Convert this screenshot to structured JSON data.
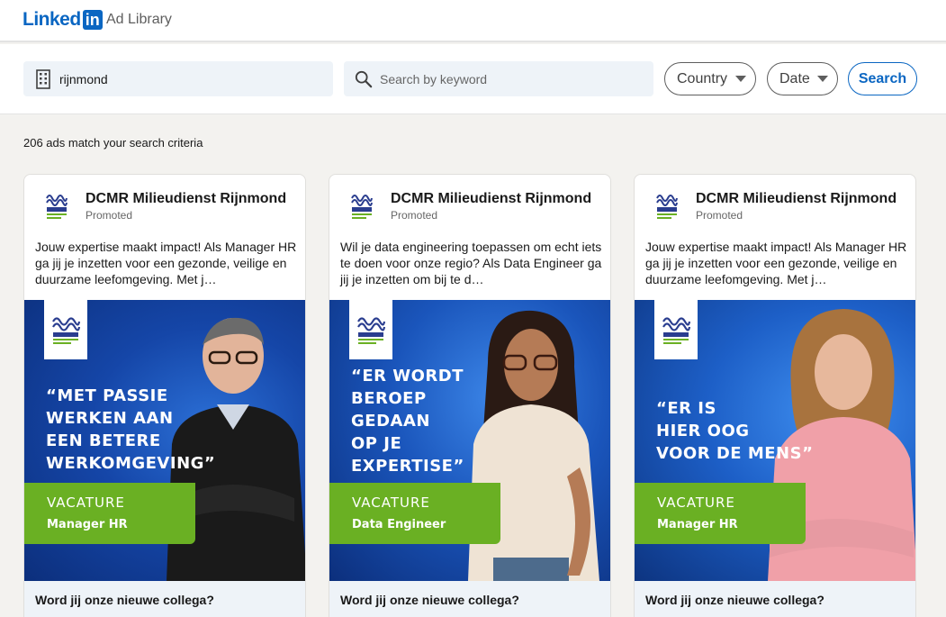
{
  "header": {
    "brand_word": "Linked",
    "brand_box": "in",
    "product": "Ad Library"
  },
  "search": {
    "company_value": "rijnmond",
    "keyword_placeholder": "Search by keyword",
    "country_label": "Country",
    "date_label": "Date",
    "search_button": "Search"
  },
  "results_text": "206 ads match your search criteria",
  "colors": {
    "brand": "#0a66c2",
    "vacature_green": "#6ab023",
    "creative_blue": "#1546a8",
    "footer_bg": "#eef3f8"
  },
  "cards": [
    {
      "advertiser": "DCMR Milieudienst Rijnmond",
      "promoted": "Promoted",
      "body": "Jouw expertise maakt impact! Als Manager HR ga jij je inzetten voor een gezonde, veilige en duurzame leefomgeving. Met j…",
      "quote": "“MET PASSIE\nWERKEN AAN\nEEN BETERE\nWERKOMGEVING”",
      "vacature": "VACATURE",
      "role": "Manager HR",
      "cta": "Word jij onze nieuwe collega?"
    },
    {
      "advertiser": "DCMR Milieudienst Rijnmond",
      "promoted": "Promoted",
      "body": "Wil je data engineering toepassen om echt iets te doen voor onze regio? Als Data Engineer ga jij je inzetten om bij te d…",
      "quote": "“ER WORDT\nBEROEP\nGEDAAN\nOP JE\nEXPERTISE”",
      "vacature": "VACATURE",
      "role": "Data Engineer",
      "cta": "Word jij onze nieuwe collega?"
    },
    {
      "advertiser": "DCMR Milieudienst Rijnmond",
      "promoted": "Promoted",
      "body": "Jouw expertise maakt impact! Als Manager HR ga jij je inzetten voor een gezonde, veilige en duurzame leefomgeving. Met j…",
      "quote": "“ER IS\nHIER OOG\nVOOR DE MENS”",
      "vacature": "VACATURE",
      "role": "Manager HR",
      "cta": "Word jij onze nieuwe collega?"
    }
  ]
}
